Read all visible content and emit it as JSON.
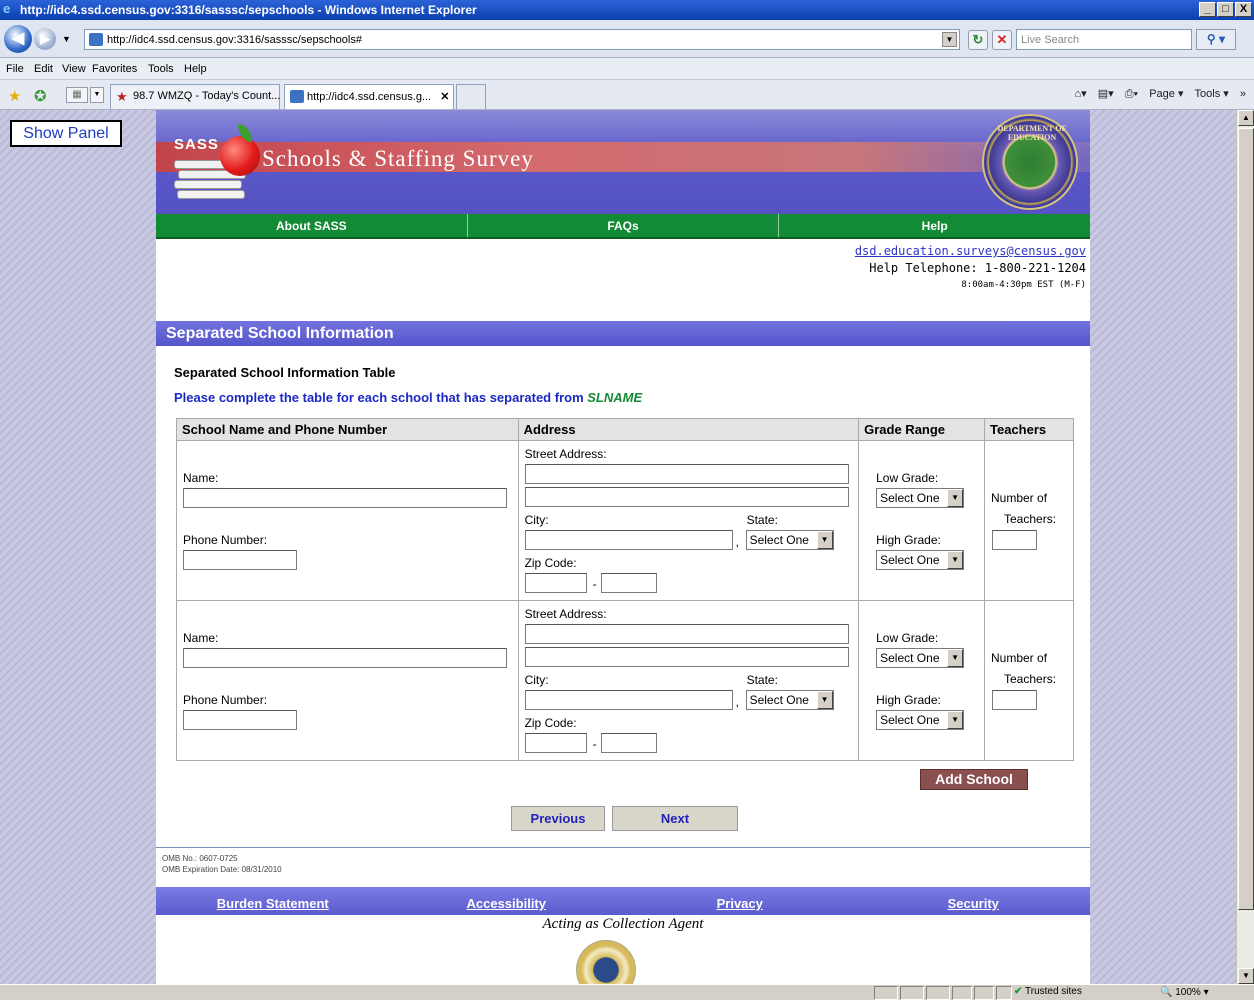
{
  "window": {
    "title": "http://idc4.ssd.census.gov:3316/sasssc/sepschools - Windows Internet Explorer",
    "controls": [
      "_",
      "□",
      "X"
    ]
  },
  "browser": {
    "address": "http://idc4.ssd.census.gov:3316/sasssc/sepschools#",
    "search_placeholder": "Live Search",
    "menu": [
      "File",
      "Edit",
      "View",
      "Favorites",
      "Tools",
      "Help"
    ],
    "tabs": [
      {
        "label": "98.7 WMZQ - Today's Count...",
        "active": false
      },
      {
        "label": "http://idc4.ssd.census.g...",
        "active": true
      }
    ],
    "command_bar": [
      "Page ▾",
      "Tools ▾"
    ],
    "show_panel": "Show Panel",
    "status": {
      "zone": "Trusted sites",
      "zoom": "100%"
    }
  },
  "site": {
    "logo_text": "SASS",
    "title": "Schools & Staffing Survey",
    "seal_text": "DEPARTMENT OF EDUCATION",
    "nav": [
      "About SASS",
      "FAQs",
      "Help"
    ],
    "contact": {
      "email": "dsd.education.surveys@census.gov",
      "phone": "Help Telephone: 1-800-221-1204",
      "hours": "8:00am-4:30pm EST (M-F)"
    }
  },
  "section": {
    "title": "Separated School Information",
    "table_title": "Separated School Information Table",
    "instruction": "Please complete the table for each school that has separated from",
    "instruction_name": "SLNAME",
    "columns": [
      "School Name and Phone Number",
      "Address",
      "Grade Range",
      "Teachers"
    ],
    "labels": {
      "name": "Name:",
      "phone": "Phone Number:",
      "street": "Street Address:",
      "city": "City:",
      "state": "State:",
      "zip": "Zip Code:",
      "low_grade": "Low Grade:",
      "high_grade": "High Grade:",
      "teachers_1": "Number of",
      "teachers_2": "Teachers:",
      "select_one": "Select One"
    },
    "buttons": {
      "add_school": "Add School",
      "previous": "Previous",
      "next": "Next"
    }
  },
  "footer": {
    "omb_no": "OMB No.: 0607-0725",
    "omb_exp": "OMB Expiration Date: 08/31/2010",
    "links": [
      "Burden Statement",
      "Accessibility",
      "Privacy",
      "Security"
    ],
    "agent": "Acting as Collection Agent"
  },
  "colors": {
    "green_nav": "#138a35",
    "section_bar": "#5656cc",
    "link_blue": "#2d35c6",
    "add_school": "#8a4f4f"
  }
}
